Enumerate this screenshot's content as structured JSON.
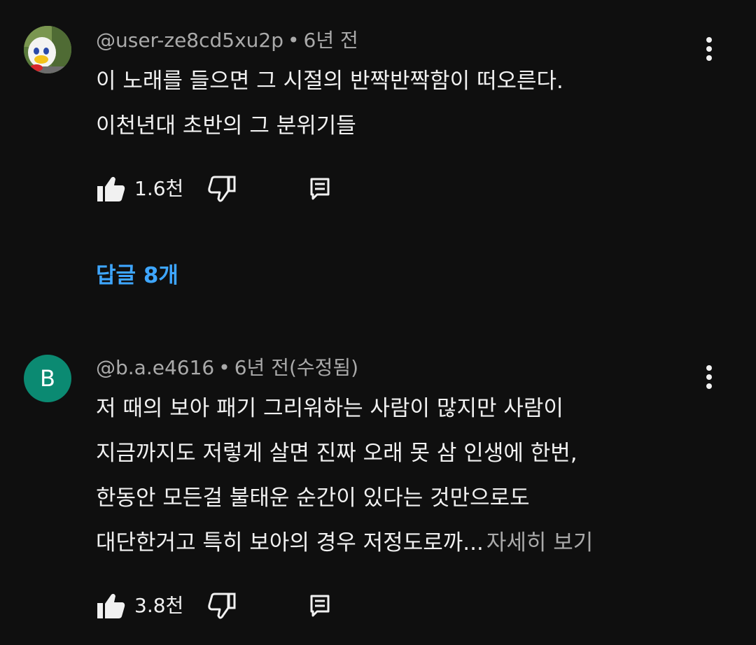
{
  "comments": [
    {
      "author": "@user-ze8cd5xu2p",
      "separator": "•",
      "time": "6년 전",
      "lines": [
        "이 노래를 들으면 그 시절의 반짝반짝함이 떠오른다.",
        "이천년대 초반의 그 분위기들"
      ],
      "likes": "1.6천",
      "replies_label": "답글 8개"
    },
    {
      "author": "@b.a.e4616",
      "separator": "•",
      "time": "6년 전(수정됨)",
      "avatar_letter": "B",
      "lines": [
        "저 때의 보아 패기 그리워하는 사람이 많지만 사람이",
        "지금까지도 저렇게 살면 진짜 오래 못 삼 인생에 한번,",
        "한동안 모든걸 불태운 순간이 있다는 것만으로도",
        "대단한거고 특히 보아의 경우 저정도로까..."
      ],
      "more_label": "자세히 보기",
      "likes": "3.8천"
    }
  ],
  "colors": {
    "background": "#0f0f0f",
    "text": "#f1f1f1",
    "secondary": "#aaaaaa",
    "link": "#3ea6ff",
    "avatar_b": "#0b8a72"
  },
  "icons": [
    "thumbs-up-icon",
    "thumbs-down-icon",
    "reply-icon",
    "more-vert-icon"
  ]
}
